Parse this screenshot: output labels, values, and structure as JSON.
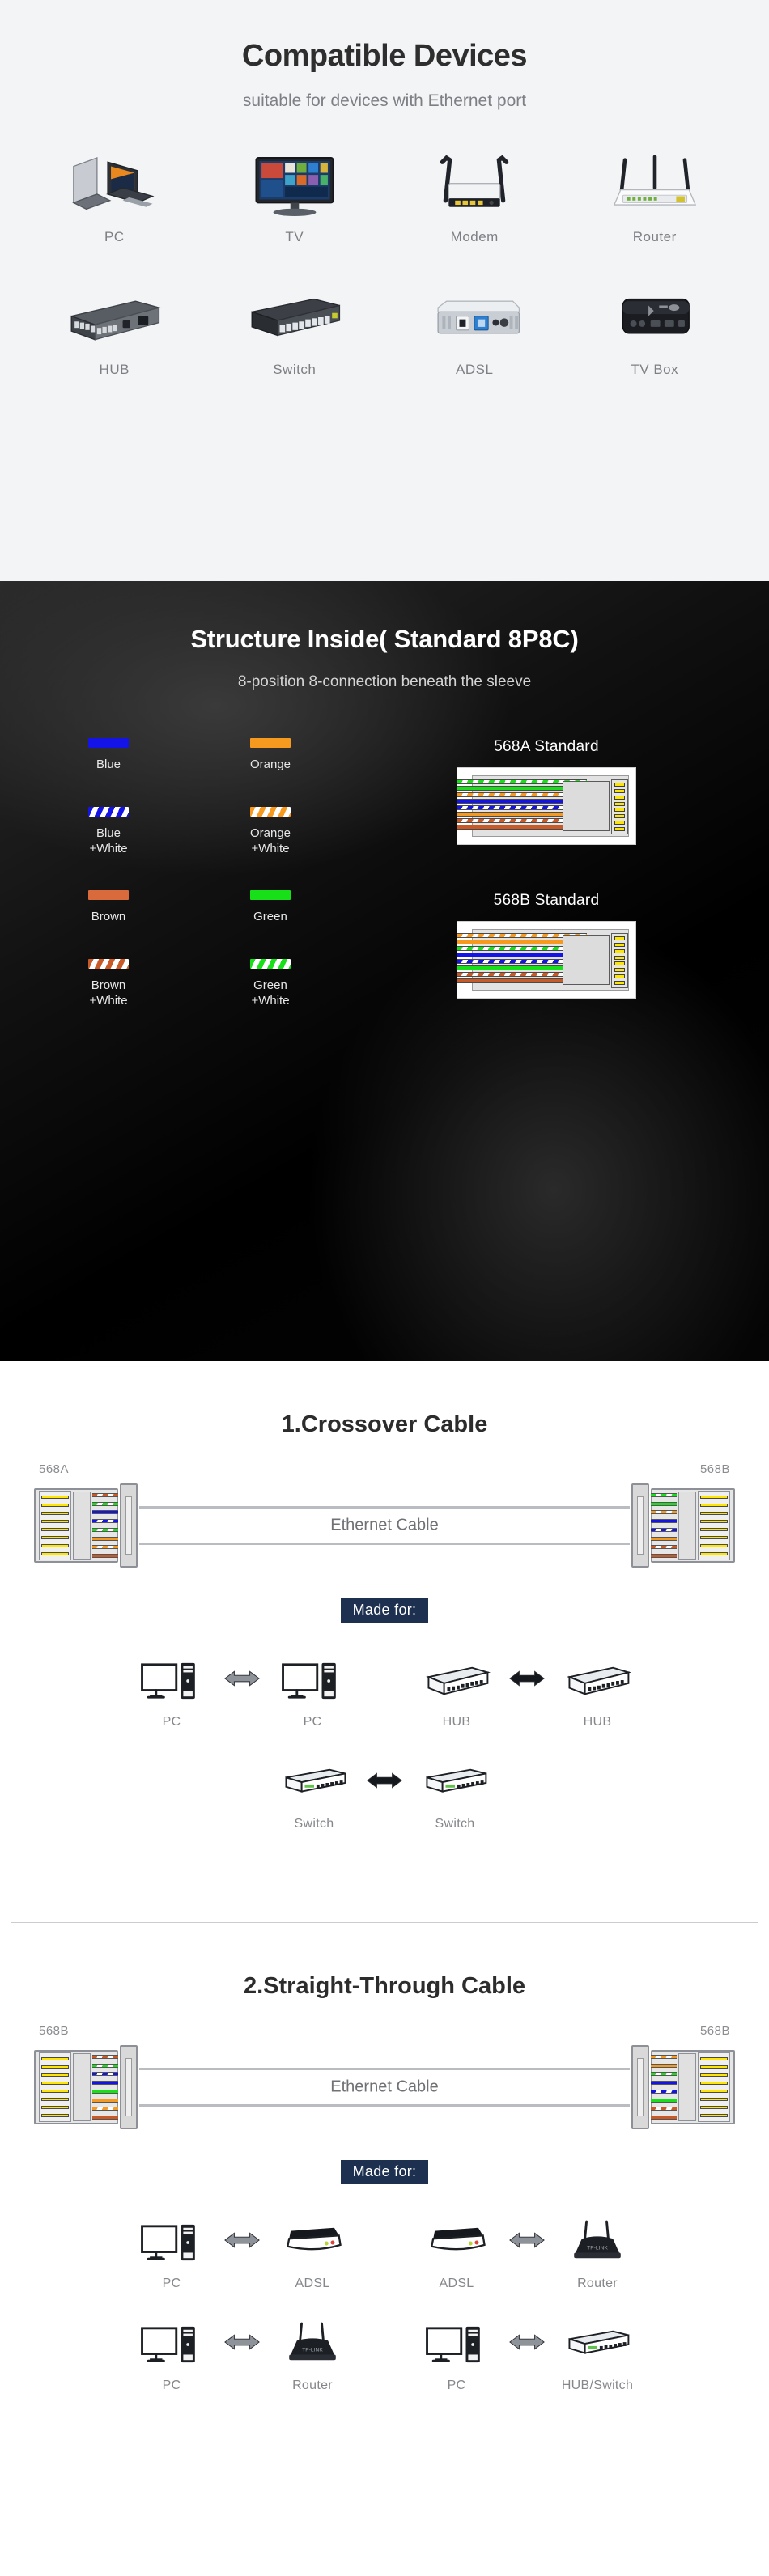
{
  "devices_section": {
    "title": "Compatible Devices",
    "subtitle": "suitable for devices with Ethernet port",
    "items": [
      {
        "label": "PC",
        "icon": "laptop-icon"
      },
      {
        "label": "TV",
        "icon": "tv-icon"
      },
      {
        "label": "Modem",
        "icon": "modem-icon"
      },
      {
        "label": "Router",
        "icon": "router-icon"
      },
      {
        "label": "HUB",
        "icon": "hub-icon"
      },
      {
        "label": "Switch",
        "icon": "switch-icon"
      },
      {
        "label": "ADSL",
        "icon": "adsl-icon"
      },
      {
        "label": "TV Box",
        "icon": "tvbox-icon"
      }
    ]
  },
  "structure_section": {
    "title": "Structure Inside( Standard 8P8C)",
    "subtitle": "8-position 8-connection beneath the sleeve",
    "legend": [
      {
        "label": "Blue",
        "color": "#1414e6",
        "striped": false
      },
      {
        "label": "Orange",
        "color": "#f59a1e",
        "striped": false
      },
      {
        "label": "Blue\n+White",
        "color": "#1414e6",
        "striped": true
      },
      {
        "label": "Orange\n+White",
        "color": "#f59a1e",
        "striped": true
      },
      {
        "label": "Brown",
        "color": "#d96a3c",
        "striped": false
      },
      {
        "label": "Green",
        "color": "#18e018",
        "striped": false
      },
      {
        "label": "Brown\n+White",
        "color": "#c85a28",
        "striped": true
      },
      {
        "label": "Green\n+White",
        "color": "#18e018",
        "striped": true
      }
    ],
    "standards": [
      {
        "title": "568A Standard",
        "wires": [
          {
            "name": "green-white",
            "color": "#18e018",
            "striped": true
          },
          {
            "name": "green",
            "color": "#18e018",
            "striped": false
          },
          {
            "name": "orange-white",
            "color": "#f59a1e",
            "striped": true
          },
          {
            "name": "blue",
            "color": "#1414e6",
            "striped": false
          },
          {
            "name": "blue-white",
            "color": "#1414e6",
            "striped": true
          },
          {
            "name": "orange",
            "color": "#f59a1e",
            "striped": false
          },
          {
            "name": "brown-white",
            "color": "#c85a28",
            "striped": true
          },
          {
            "name": "brown",
            "color": "#c85a28",
            "striped": false
          }
        ]
      },
      {
        "title": "568B Standard",
        "wires": [
          {
            "name": "orange-white",
            "color": "#f59a1e",
            "striped": true
          },
          {
            "name": "orange",
            "color": "#f59a1e",
            "striped": false
          },
          {
            "name": "green-white",
            "color": "#18e018",
            "striped": true
          },
          {
            "name": "blue",
            "color": "#1414e6",
            "striped": false
          },
          {
            "name": "blue-white",
            "color": "#1414e6",
            "striped": true
          },
          {
            "name": "green",
            "color": "#18e018",
            "striped": false
          },
          {
            "name": "brown-white",
            "color": "#c85a28",
            "striped": true
          },
          {
            "name": "brown",
            "color": "#c85a28",
            "striped": false
          }
        ]
      }
    ],
    "pin_count": 8,
    "pin_color": "#ffe600"
  },
  "cable_sections": [
    {
      "title": "1.Crossover Cable",
      "left_end_label": "568A",
      "right_end_label": "568B",
      "cable_label": "Ethernet Cable",
      "made_for_label": "Made for:",
      "left_wires": [
        {
          "color": "#c85a28",
          "striped": true
        },
        {
          "color": "#18e018",
          "striped": true
        },
        {
          "color": "#1414e6",
          "striped": false
        },
        {
          "color": "#1414e6",
          "striped": true
        },
        {
          "color": "#18e018",
          "striped": true
        },
        {
          "color": "#f59a1e",
          "striped": false
        },
        {
          "color": "#f59a1e",
          "striped": true
        },
        {
          "color": "#c85a28",
          "striped": false
        }
      ],
      "right_wires": [
        {
          "color": "#18e018",
          "striped": true
        },
        {
          "color": "#18e018",
          "striped": false
        },
        {
          "color": "#f59a1e",
          "striped": true
        },
        {
          "color": "#1414e6",
          "striped": false
        },
        {
          "color": "#1414e6",
          "striped": true
        },
        {
          "color": "#f59a1e",
          "striped": false
        },
        {
          "color": "#c85a28",
          "striped": true
        },
        {
          "color": "#c85a28",
          "striped": false
        }
      ],
      "pair_rows": [
        [
          {
            "left": {
              "label": "PC",
              "icon": "pc-icon"
            },
            "right": {
              "label": "PC",
              "icon": "pc-icon"
            }
          },
          {
            "left": {
              "label": "HUB",
              "icon": "hub-icon"
            },
            "right": {
              "label": "HUB",
              "icon": "hub-icon"
            }
          }
        ],
        [
          {
            "left": {
              "label": "Switch",
              "icon": "switch-icon"
            },
            "right": {
              "label": "Switch",
              "icon": "switch-icon"
            }
          }
        ]
      ]
    },
    {
      "title": "2.Straight-Through Cable",
      "left_end_label": "568B",
      "right_end_label": "568B",
      "cable_label": "Ethernet Cable",
      "made_for_label": "Made for:",
      "left_wires": [
        {
          "color": "#c85a28",
          "striped": true
        },
        {
          "color": "#18e018",
          "striped": true
        },
        {
          "color": "#1414e6",
          "striped": true
        },
        {
          "color": "#1414e6",
          "striped": false
        },
        {
          "color": "#18e018",
          "striped": false
        },
        {
          "color": "#f59a1e",
          "striped": false
        },
        {
          "color": "#f59a1e",
          "striped": true
        },
        {
          "color": "#c85a28",
          "striped": false
        }
      ],
      "right_wires": [
        {
          "color": "#f59a1e",
          "striped": true
        },
        {
          "color": "#f59a1e",
          "striped": false
        },
        {
          "color": "#18e018",
          "striped": true
        },
        {
          "color": "#1414e6",
          "striped": false
        },
        {
          "color": "#1414e6",
          "striped": true
        },
        {
          "color": "#18e018",
          "striped": false
        },
        {
          "color": "#c85a28",
          "striped": true
        },
        {
          "color": "#c85a28",
          "striped": false
        }
      ],
      "pair_rows": [
        [
          {
            "left": {
              "label": "PC",
              "icon": "pc-icon"
            },
            "right": {
              "label": "ADSL",
              "icon": "adsl-icon"
            }
          },
          {
            "left": {
              "label": "ADSL",
              "icon": "adsl-icon"
            },
            "right": {
              "label": "Router",
              "icon": "router-icon"
            }
          }
        ],
        [
          {
            "left": {
              "label": "PC",
              "icon": "pc-icon"
            },
            "right": {
              "label": "Router",
              "icon": "router-icon"
            }
          },
          {
            "left": {
              "label": "PC",
              "icon": "pc-icon"
            },
            "right": {
              "label": "HUB/Switch",
              "icon": "switch-icon"
            }
          }
        ]
      ]
    }
  ]
}
